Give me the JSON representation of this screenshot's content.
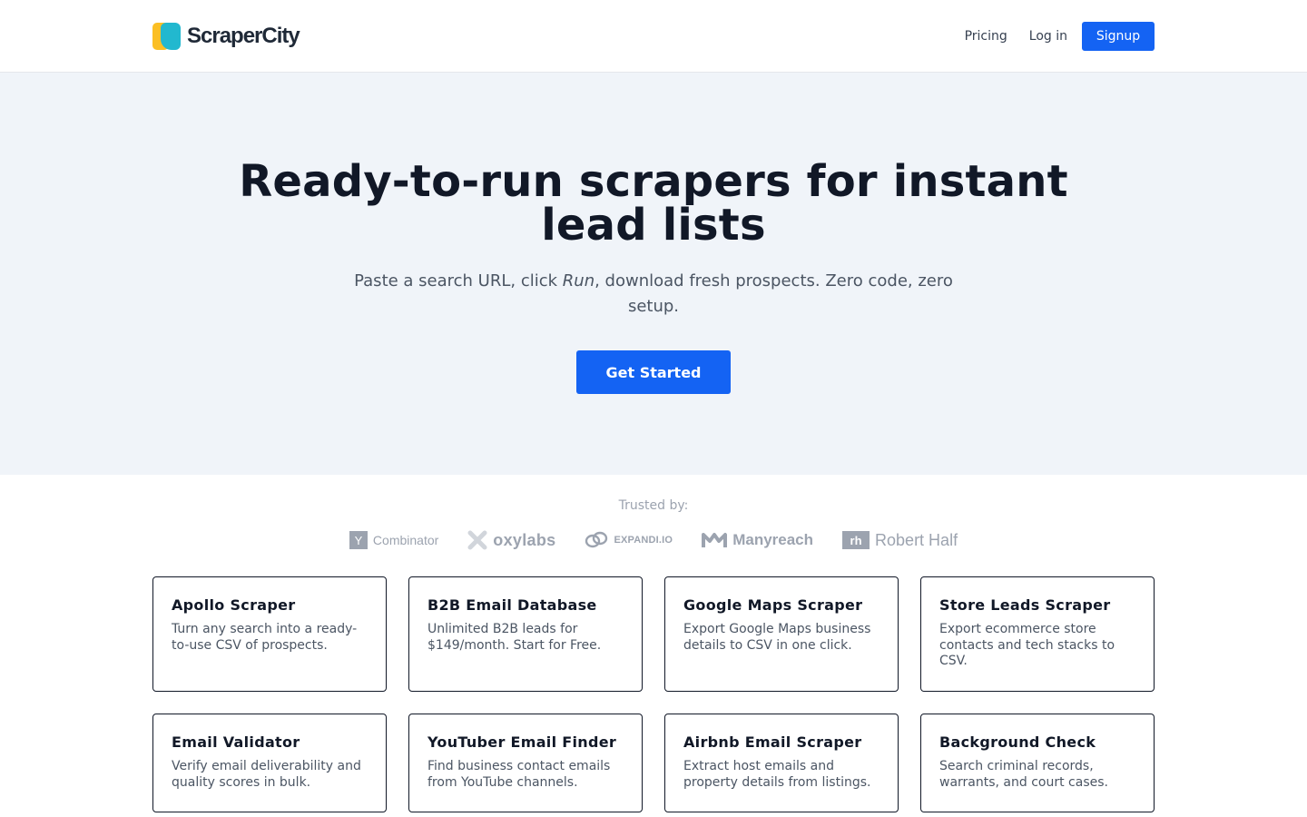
{
  "header": {
    "logo_text": "ScraperCity",
    "nav": {
      "pricing": "Pricing",
      "login": "Log in",
      "signup": "Signup"
    }
  },
  "hero": {
    "title": "Ready-to-run scrapers for instant lead lists",
    "subtitle_before": "Paste a search URL, click ",
    "subtitle_em": "Run",
    "subtitle_after": ", download fresh prospects. Zero code, zero setup.",
    "cta": "Get Started"
  },
  "trusted": {
    "label": "Trusted by:",
    "logos": {
      "yc_mark": "Y",
      "yc_text": "Combinator",
      "oxylabs": "oxylabs",
      "expandi": "EXPANDI.IO",
      "manyreach": "Manyreach",
      "rh_mark": "rh",
      "roberthalf": "Robert Half"
    }
  },
  "cards": [
    {
      "title": "Apollo Scraper",
      "desc": "Turn any search into a ready-to-use CSV of prospects."
    },
    {
      "title": "B2B Email Database",
      "desc": "Unlimited B2B leads for $149/month. Start for Free."
    },
    {
      "title": "Google Maps Scraper",
      "desc": "Export Google Maps business details to CSV in one click."
    },
    {
      "title": "Store Leads Scraper",
      "desc": "Export ecommerce store contacts and tech stacks to CSV."
    },
    {
      "title": "Email Validator",
      "desc": "Verify email deliverability and quality scores in bulk."
    },
    {
      "title": "YouTuber Email Finder",
      "desc": "Find business contact emails from YouTube channels."
    },
    {
      "title": "Airbnb Email Scraper",
      "desc": "Extract host emails and property details from listings."
    },
    {
      "title": "Background Check",
      "desc": "Search criminal records, warrants, and court cases."
    }
  ],
  "colors": {
    "primary": "#1463f3",
    "hero_bg": "#f0f4f9",
    "logo_yellow": "#fbbf24",
    "logo_teal": "#22b8cf"
  }
}
